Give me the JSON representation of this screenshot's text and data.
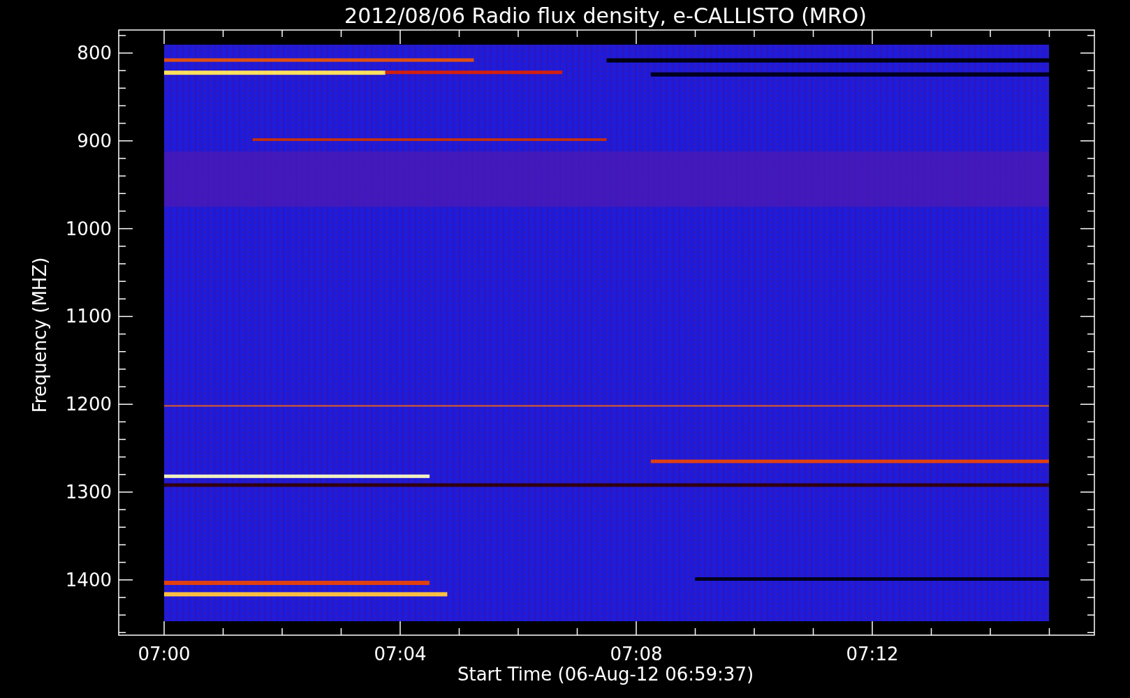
{
  "title": "2012/08/06  Radio flux density, e-CALLISTO (MRO)",
  "y_axis": {
    "title": "Frequency (MHZ)",
    "tick_labels": [
      "800",
      "900",
      "1000",
      "1100",
      "1200",
      "1300",
      "1400"
    ]
  },
  "x_axis": {
    "title": "Start Time (06-Aug-12 06:59:37)",
    "tick_labels": [
      "07:00",
      "07:04",
      "07:08",
      "07:12"
    ]
  }
}
